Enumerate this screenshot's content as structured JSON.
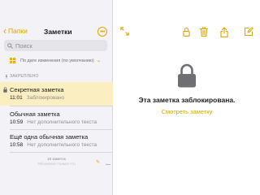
{
  "colors": {
    "accent": "#e0a300",
    "selected_row": "#fbeec1",
    "sidebar_bg": "#f2f2f7",
    "lock_gray": "#6e6e73"
  },
  "sidebar": {
    "back_label": "Папки",
    "title": "Заметки",
    "more_icon": "ellipsis-circle-icon",
    "search": {
      "placeholder": "Поиск",
      "value": ""
    },
    "sort_label": "По дате изменения (по умолчанию)",
    "pinned_header": "ЗАКРЕПЛЕНО",
    "notes": [
      {
        "title": "Секретная заметка",
        "time": "11:01",
        "preview": "Заблокировано",
        "locked": true,
        "selected": true
      },
      {
        "title": "Обычная заметка",
        "time": "10:59",
        "preview": "Нет дополнительного текста",
        "locked": false,
        "selected": false
      },
      {
        "title": "Ещё одна обычная заметка",
        "time": "10:58",
        "preview": "Нет дополнительного текста",
        "locked": false,
        "selected": false
      }
    ],
    "count_text": "18 заметок",
    "count_sub": "Обновлено только что"
  },
  "detail": {
    "toolbar_icons": [
      "expand-icon",
      "lock-icon",
      "trash-icon",
      "share-icon",
      "compose-icon"
    ],
    "locked_message": "Эта заметка заблокирована.",
    "view_link": "Смотреть заметку"
  }
}
